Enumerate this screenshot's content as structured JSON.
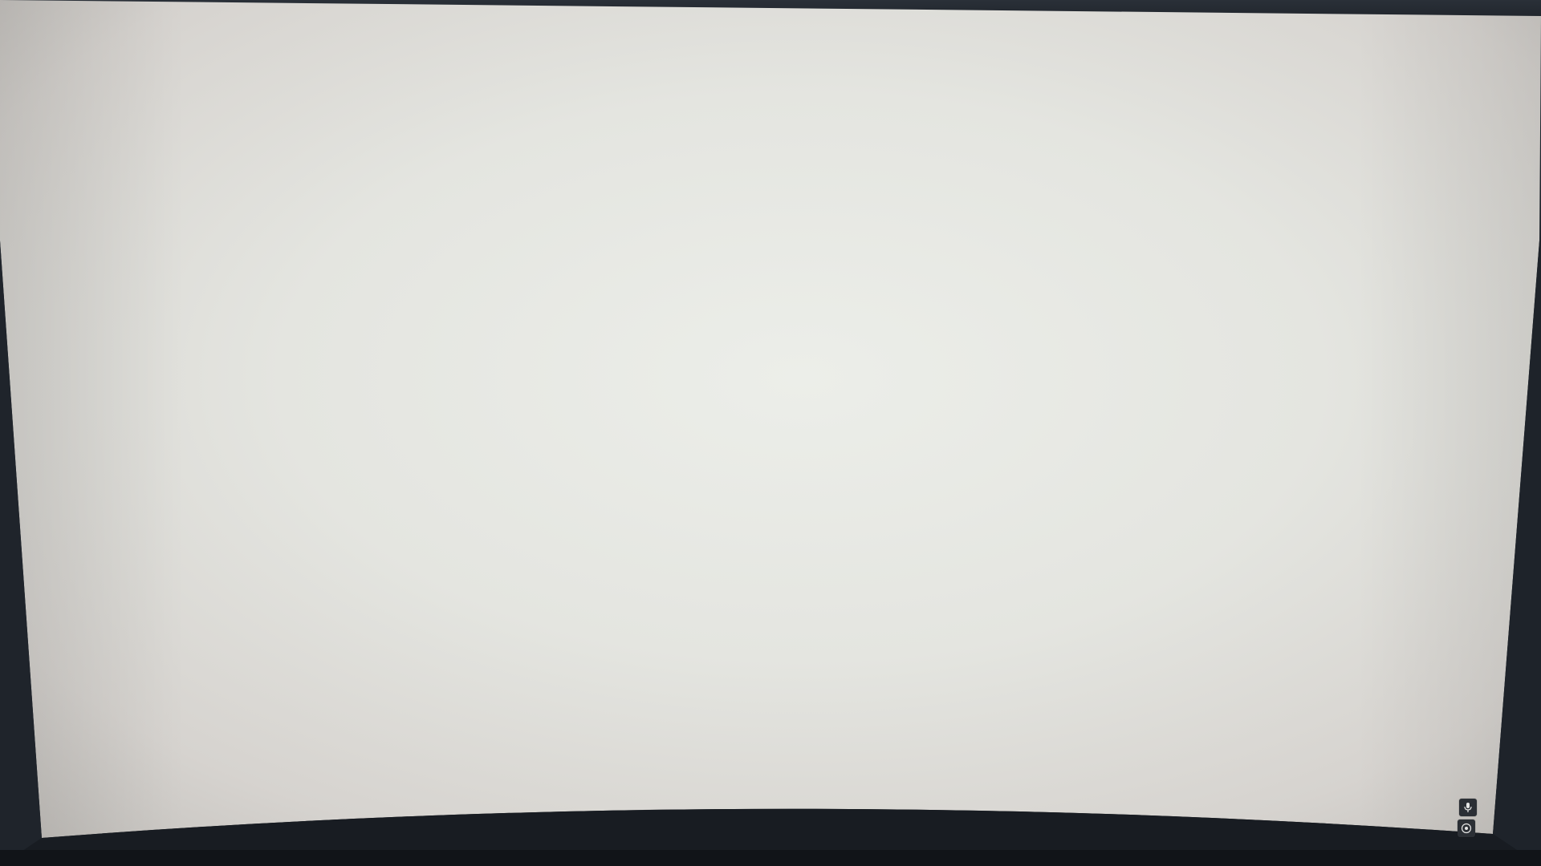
{
  "scene": {
    "description_type": "photo-of-monitor",
    "screen_state": "blank",
    "colors": {
      "screen_center": "#e9ebe6",
      "screen_edge": "#c9c6c2",
      "bezel": "#1c2128"
    }
  },
  "overlay": {
    "icons": [
      "microphone-icon",
      "camera-icon"
    ]
  }
}
